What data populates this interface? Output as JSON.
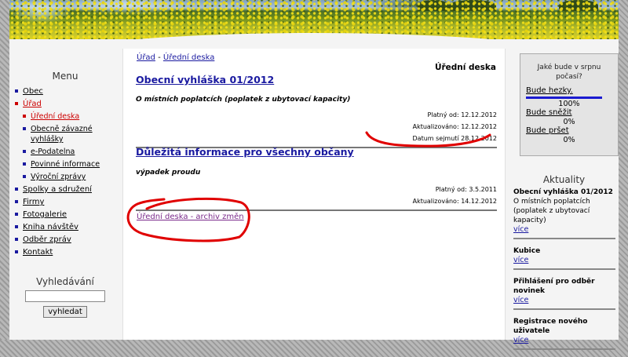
{
  "breadcrumb": {
    "home": "Úřad",
    "sep": " - ",
    "current": "Úřední deska"
  },
  "page_heading": "Úřední deska",
  "menu": {
    "title": "Menu",
    "items": [
      {
        "label": "Obec",
        "level": 1
      },
      {
        "label": "Úřad",
        "level": 1,
        "active": true
      },
      {
        "label": "Úřední deska",
        "level": 2,
        "active": true
      },
      {
        "label": "Obecně závazné vyhlášky",
        "level": 2
      },
      {
        "label": "e-Podatelna",
        "level": 2
      },
      {
        "label": "Povinné informace",
        "level": 2
      },
      {
        "label": "Výroční zprávy",
        "level": 2
      },
      {
        "label": "Spolky a sdružení",
        "level": 1
      },
      {
        "label": "Firmy",
        "level": 1
      },
      {
        "label": "Fotogalerie",
        "level": 1
      },
      {
        "label": "Kniha návštěv",
        "level": 1
      },
      {
        "label": "Odběr zpráv",
        "level": 1
      },
      {
        "label": "Kontakt",
        "level": 1
      }
    ]
  },
  "search": {
    "title": "Vyhledávání",
    "value": "",
    "button": "vyhledat"
  },
  "entries": [
    {
      "title": "Obecní vyhláška 01/2012",
      "subtitle": "O místních poplatcích (poplatek z ubytovací kapacity)",
      "meta": [
        "Platný od: 12.12.2012",
        "Aktualizováno: 12.12.2012",
        "Datum sejmutí 28.12.2012"
      ]
    },
    {
      "title": "Důležitá informace pro všechny občany",
      "subtitle": "výpadek proudu",
      "meta": [
        "Platný od: 3.5.2011",
        "Aktualizováno: 14.12.2012"
      ]
    }
  ],
  "archive_link": "Úřední deska - archiv změn",
  "poll": {
    "question": "Jaké bude v srpnu počasí?",
    "options": [
      {
        "label": "Bude hezky.",
        "percent": 100,
        "percent_label": "100%"
      },
      {
        "label": "Bude sněžit",
        "percent": 0,
        "percent_label": "0%"
      },
      {
        "label": "Bude pršet",
        "percent": 0,
        "percent_label": "0%"
      }
    ]
  },
  "news": {
    "title": "Aktuality",
    "items": [
      {
        "title": "Obecní vyhláška 01/2012",
        "desc": "O místních poplatcích (poplatek z ubytovací kapacity)",
        "link": "více"
      },
      {
        "title": "Kubice",
        "desc": "",
        "link": "více"
      },
      {
        "title": "Přihlášení pro odběr novinek",
        "desc": "",
        "link": "více"
      },
      {
        "title": "Registrace nového uživatele",
        "desc": "",
        "link": "více"
      }
    ]
  },
  "colors": {
    "link": "#1a1aa0",
    "active": "#cc0000",
    "annotation": "#e00000",
    "poll_bar": "#1a1ad0"
  }
}
